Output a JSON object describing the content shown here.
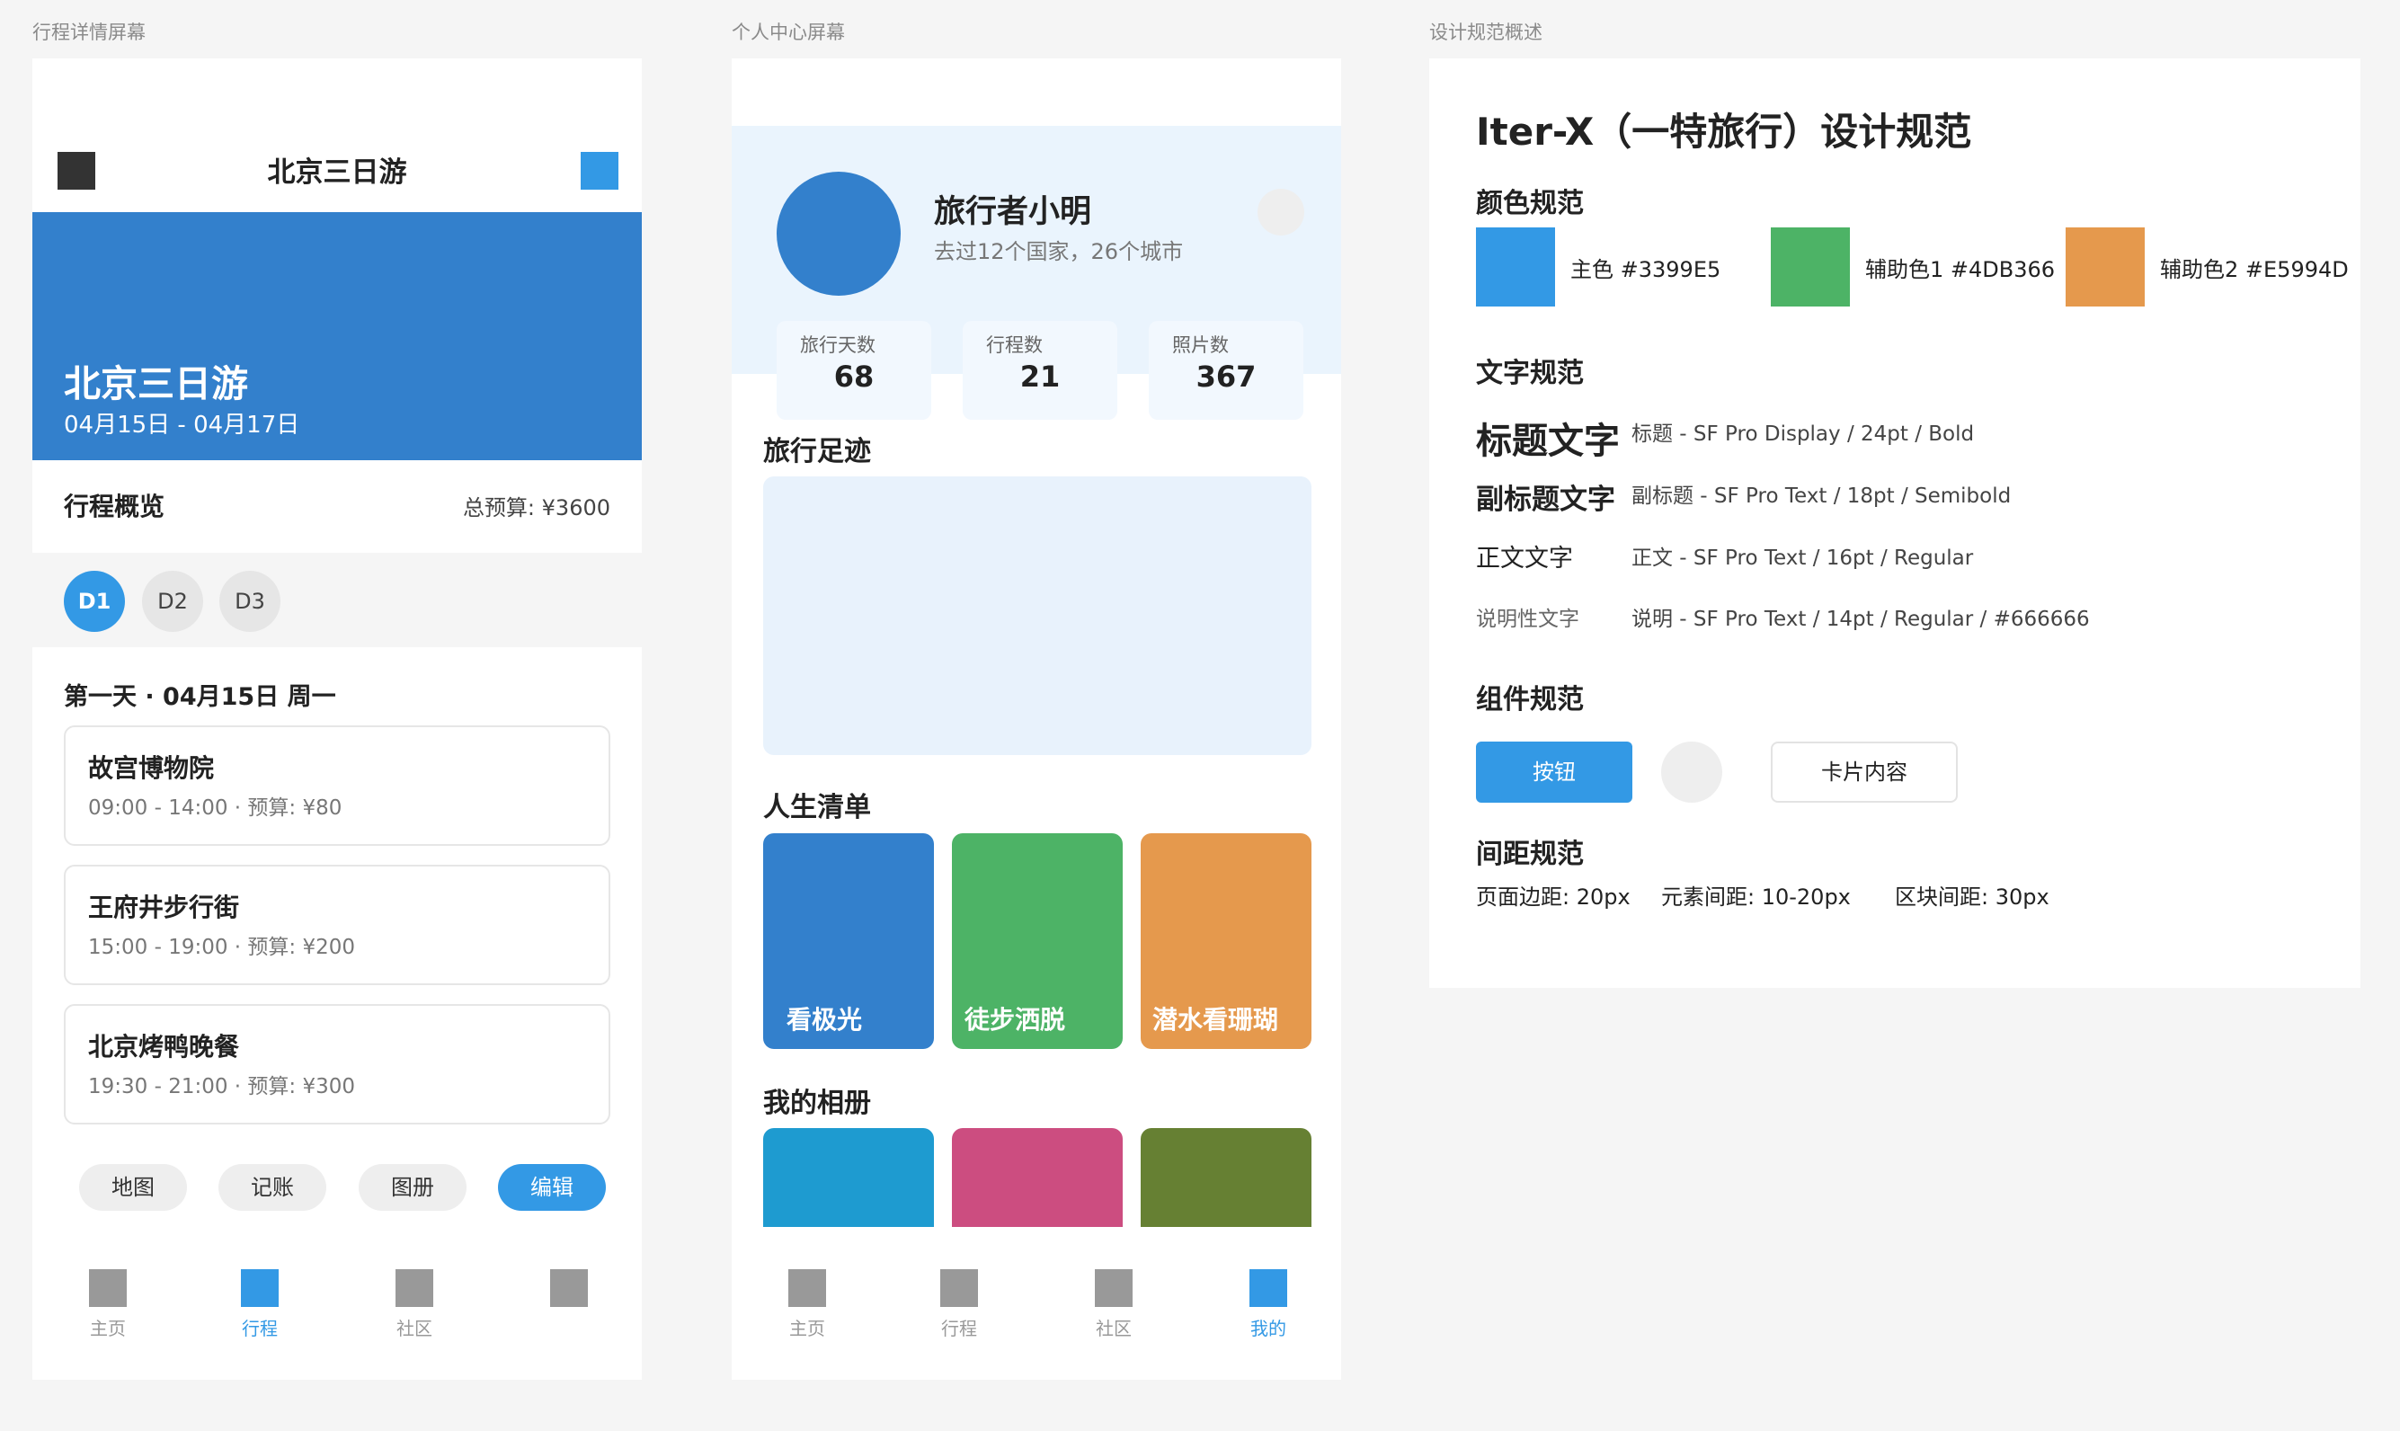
{
  "colors": {
    "primary": "#3399E5",
    "secondary1": "#4DB366",
    "secondary2": "#E5994D",
    "hero_blue": "#3380CC",
    "nav_dark": "#333333",
    "tab_gray": "#999999",
    "caption": "#666666",
    "light_bg": "#E8F2FC",
    "bucket_blue": "#3380CC",
    "bucket_green": "#4DB366",
    "bucket_orange": "#E5994D",
    "album_cyan": "#1E9BD0",
    "album_pink": "#CC4D80",
    "album_olive": "#668033"
  },
  "frames": {
    "trip_detail_label": "行程详情屏幕",
    "profile_label": "个人中心屏幕",
    "spec_label": "设计规范概述"
  },
  "trip": {
    "nav_title": "北京三日游",
    "nav_left_icon": "back-icon",
    "nav_right_icon": "share-icon",
    "hero_title": "北京三日游",
    "hero_dates": "04月15日 - 04月17日",
    "overview_title": "行程概览",
    "budget": "总预算: ¥3600",
    "days": [
      "D1",
      "D2",
      "D3"
    ],
    "selected_day": "D1",
    "day_heading": "第一天 · 04月15日 周一",
    "activities": [
      {
        "name": "故宫博物院",
        "meta": "09:00 - 14:00 · 预算: ¥80"
      },
      {
        "name": "王府井步行街",
        "meta": "15:00 - 19:00 · 预算: ¥200"
      },
      {
        "name": "北京烤鸭晚餐",
        "meta": "19:30 - 21:00 · 预算: ¥300"
      }
    ],
    "actions": [
      "地图",
      "记账",
      "图册",
      "编辑"
    ],
    "active_action": "编辑",
    "tabs": [
      "主页",
      "行程",
      "社区",
      ""
    ],
    "active_tab": "行程"
  },
  "profile": {
    "name": "旅行者小明",
    "subtitle": "去过12个国家，26个城市",
    "stats": [
      {
        "label": "旅行天数",
        "value": "68"
      },
      {
        "label": "行程数",
        "value": "21"
      },
      {
        "label": "照片数",
        "value": "367"
      }
    ],
    "footprint_title": "旅行足迹",
    "bucket_title": "人生清单",
    "bucket_items": [
      "看极光",
      "徒步洒脱",
      "潜水看珊瑚"
    ],
    "album_title": "我的相册",
    "tabs": [
      "主页",
      "行程",
      "社区",
      "我的"
    ],
    "active_tab": "我的"
  },
  "spec": {
    "title": "Iter-X（一特旅行）设计规范",
    "color_heading": "颜色规范",
    "color_items": [
      {
        "label": "主色 #3399E5",
        "color": "#3399E5"
      },
      {
        "label": "辅助色1 #4DB366",
        "color": "#4DB366"
      },
      {
        "label": "辅助色2 #E5994D",
        "color": "#E5994D"
      }
    ],
    "text_heading": "文字规范",
    "type_samples": [
      {
        "sample": "标题文字",
        "desc": "标题 - SF Pro Display / 24pt / Bold"
      },
      {
        "sample": "副标题文字",
        "desc": "副标题 - SF Pro Text / 18pt / Semibold"
      },
      {
        "sample": "正文文字",
        "desc": "正文 - SF Pro Text / 16pt / Regular"
      },
      {
        "sample": "说明性文字",
        "desc": "说明 - SF Pro Text / 14pt / Regular / #666666"
      }
    ],
    "component_heading": "组件规范",
    "button_label": "按钮",
    "card_label": "卡片内容",
    "spacing_heading": "间距规范",
    "spacing_items": [
      "页面边距: 20px",
      "元素间距: 10-20px",
      "区块间距: 30px"
    ]
  }
}
